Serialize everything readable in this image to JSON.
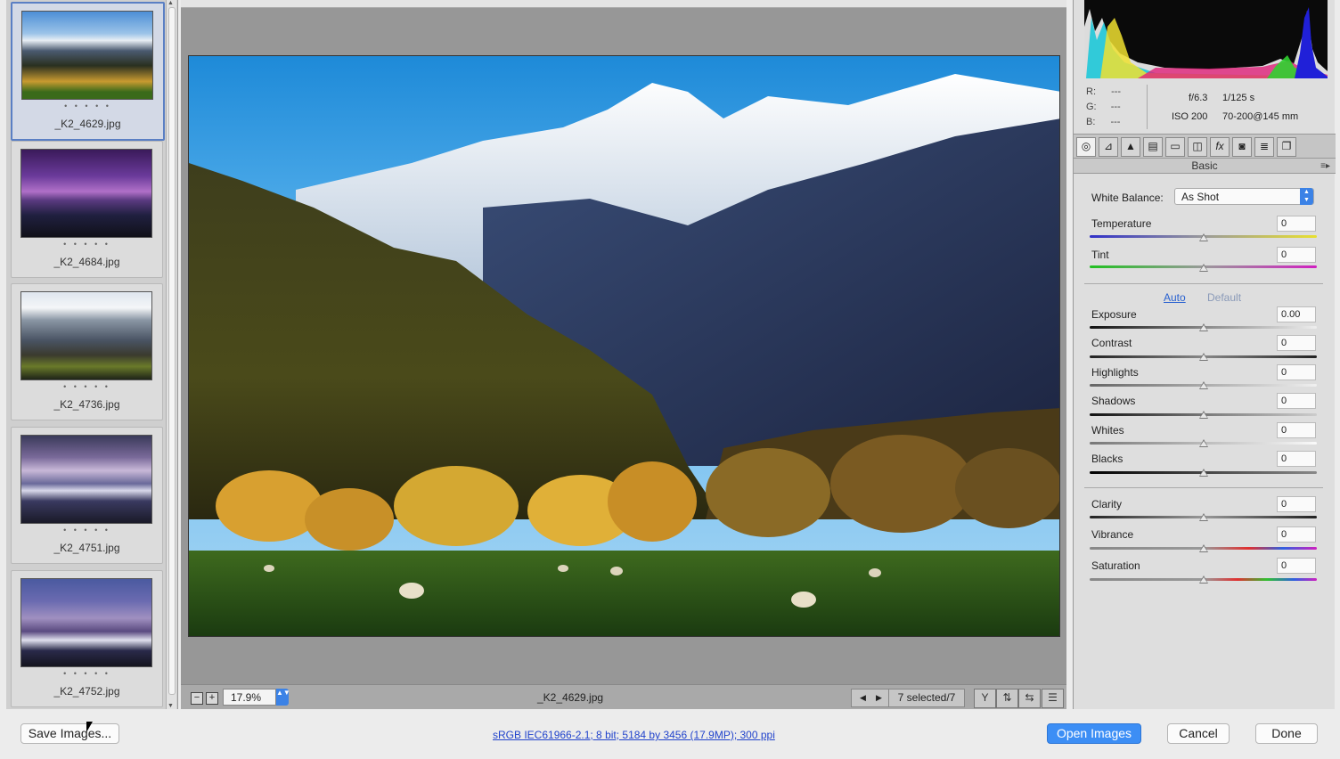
{
  "filmstrip": {
    "items": [
      {
        "name": "_K2_4629.jpg",
        "rating": "• • • • •",
        "selected": true
      },
      {
        "name": "_K2_4684.jpg",
        "rating": "• • • • •",
        "selected": false
      },
      {
        "name": "_K2_4736.jpg",
        "rating": "• • • • •",
        "selected": false
      },
      {
        "name": "_K2_4751.jpg",
        "rating": "• • • • •",
        "selected": false
      },
      {
        "name": "_K2_4752.jpg",
        "rating": "• • • • •",
        "selected": false
      }
    ]
  },
  "preview": {
    "zoom_out_label": "−",
    "zoom_in_label": "+",
    "zoom": "17.9%",
    "zoom_stepper": "▲▼",
    "filename": "_K2_4629.jpg",
    "prev_arrow": "◀",
    "next_arrow": "▶",
    "selected_count": "7 selected/7"
  },
  "readout": {
    "r_label": "R:",
    "r_value": "---",
    "g_label": "G:",
    "g_value": "---",
    "b_label": "B:",
    "b_value": "---"
  },
  "exif": {
    "aperture": "f/6.3",
    "shutter": "1/125 s",
    "iso": "ISO 200",
    "lens": "70-200@145 mm"
  },
  "panel": {
    "section_title": "Basic",
    "menu_icon": "≡▸",
    "white_balance_label": "White Balance:",
    "white_balance_value": "As Shot",
    "auto_label": "Auto",
    "default_label": "Default",
    "sliders": [
      {
        "label": "Temperature",
        "value": "0",
        "level": 0.5
      },
      {
        "label": "Tint",
        "value": "0",
        "level": 0.5
      },
      {
        "label": "Exposure",
        "value": "0.00",
        "level": 0.5
      },
      {
        "label": "Contrast",
        "value": "0",
        "level": 0.5
      },
      {
        "label": "Highlights",
        "value": "0",
        "level": 0.5
      },
      {
        "label": "Shadows",
        "value": "0",
        "level": 0.5
      },
      {
        "label": "Whites",
        "value": "0",
        "level": 0.5
      },
      {
        "label": "Blacks",
        "value": "0",
        "level": 0.5
      },
      {
        "label": "Clarity",
        "value": "0",
        "level": 0.5
      },
      {
        "label": "Vibrance",
        "value": "0",
        "level": 0.5
      },
      {
        "label": "Saturation",
        "value": "0",
        "level": 0.5
      }
    ]
  },
  "tools": [
    "aperture-icon",
    "tone-curve-icon",
    "detail-icon",
    "hsl-icon",
    "split-toning-icon",
    "lens-corrections-icon",
    "effects-icon",
    "camera-calibration-icon",
    "presets-icon",
    "snapshots-icon"
  ],
  "footer": {
    "save_images": "Save Images...",
    "info_link": "sRGB IEC61966-2.1; 8 bit; 5184 by 3456 (17.9MP); 300 ppi",
    "open_images": "Open Images",
    "cancel": "Cancel",
    "done": "Done"
  },
  "colors": {
    "accent": "#3c8ef5",
    "selection_border": "#5a7fc4"
  }
}
